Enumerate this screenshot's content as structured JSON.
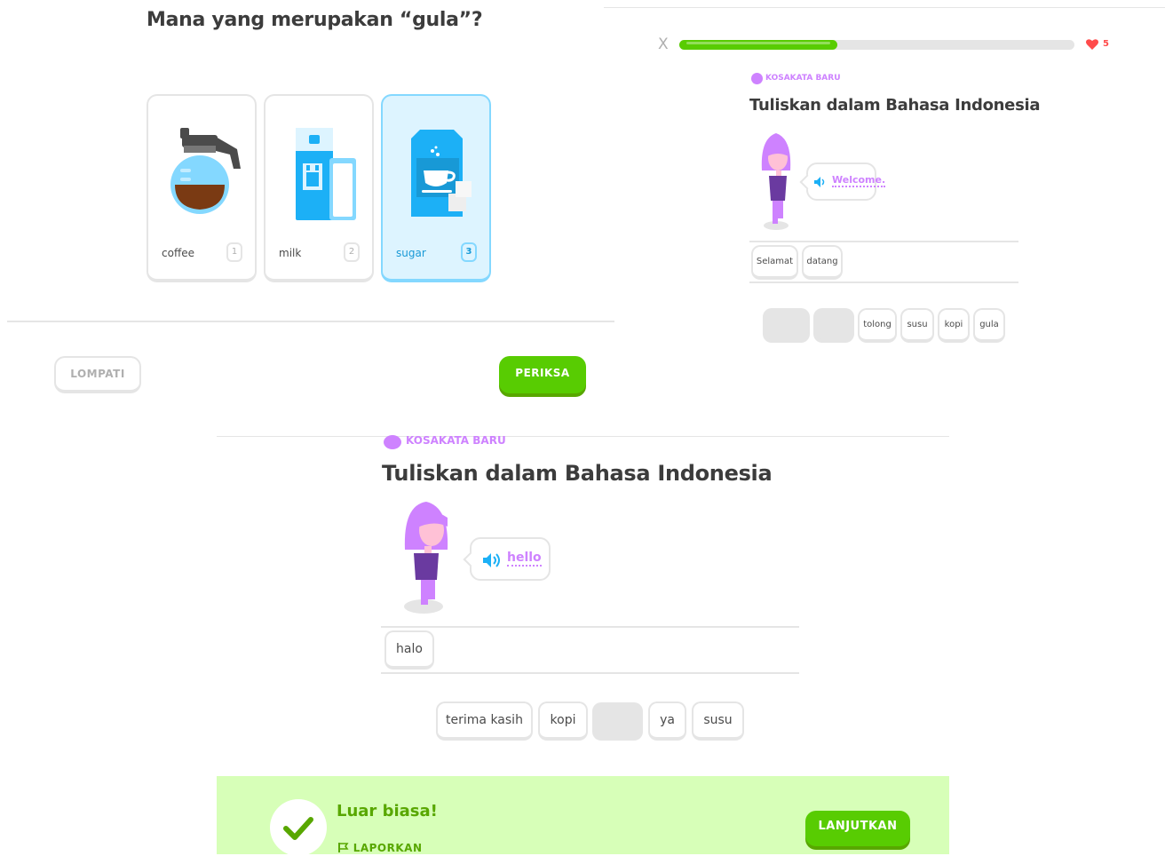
{
  "colors": {
    "brand_green": "#58cc02",
    "green_dark": "#58a700",
    "selected_blue": "#1899d6",
    "new_word_purple": "#ce82ff",
    "heart_red": "#ff4b4b",
    "success_bg": "#d7ffb8"
  },
  "panel_a": {
    "question": "Mana yang merupakan “gula”?",
    "options": [
      {
        "label": "coffee",
        "key": "1",
        "icon": "coffee-pot-icon",
        "selected": false
      },
      {
        "label": "milk",
        "key": "2",
        "icon": "milk-carton-icon",
        "selected": false
      },
      {
        "label": "sugar",
        "key": "3",
        "icon": "sugar-bag-icon",
        "selected": true
      }
    ],
    "skip_label": "LOMPATI",
    "check_label": "PERIKSA"
  },
  "panel_b": {
    "close_label": "X",
    "progress": 0.4,
    "hearts": "5",
    "badge": "KOSAKATA BARU",
    "prompt": "Tuliskan dalam Bahasa Indonesia",
    "speech_word": "Welcome.",
    "answer_tiles": [
      "Selamat",
      "datang"
    ],
    "bank_tiles": [
      "",
      "",
      "tolong",
      "susu",
      "kopi",
      "gula"
    ]
  },
  "panel_c": {
    "badge": "KOSAKATA BARU",
    "prompt": "Tuliskan dalam Bahasa Indonesia",
    "speech_word": "hello",
    "answer_tiles": [
      "halo"
    ],
    "bank_tiles": [
      "terima kasih",
      "kopi",
      "",
      "ya",
      "susu"
    ],
    "feedback_title": "Luar biasa!",
    "report_label": "LAPORKAN",
    "continue_label": "LANJUTKAN"
  }
}
